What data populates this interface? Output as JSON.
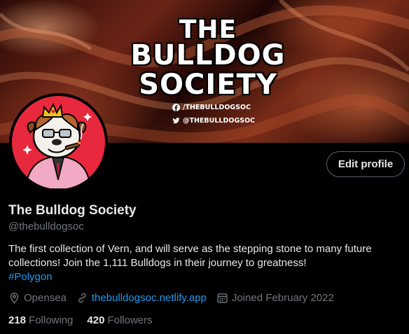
{
  "banner": {
    "title_line1": "THE",
    "title_line2": "BULLDOG",
    "title_line3": "SOCIETY",
    "facebook": "/THEBULLDOGSOC",
    "twitter": "@THEBULLDOGSOC"
  },
  "actions": {
    "edit_profile": "Edit profile"
  },
  "profile": {
    "name": "The Bulldog Society",
    "handle": "@thebulldogsoc",
    "bio": "The first collection of Vern, and will serve as the stepping stone to many future collections! Join the 1,111 Bulldogs in their journey to greatness!",
    "hashtag": "#Polygon",
    "location": "Opensea",
    "website": "thebulldogsoc.netlify.app",
    "joined": "Joined February 2022"
  },
  "stats": {
    "following_count": "218",
    "following_label": "Following",
    "followers_count": "420",
    "followers_label": "Followers"
  },
  "colors": {
    "accent": "#1d9bf0",
    "muted": "#71767b",
    "avatar_bg": "#e8283d"
  },
  "icons": [
    "facebook-icon",
    "twitter-icon",
    "location-icon",
    "link-icon",
    "calendar-icon"
  ]
}
